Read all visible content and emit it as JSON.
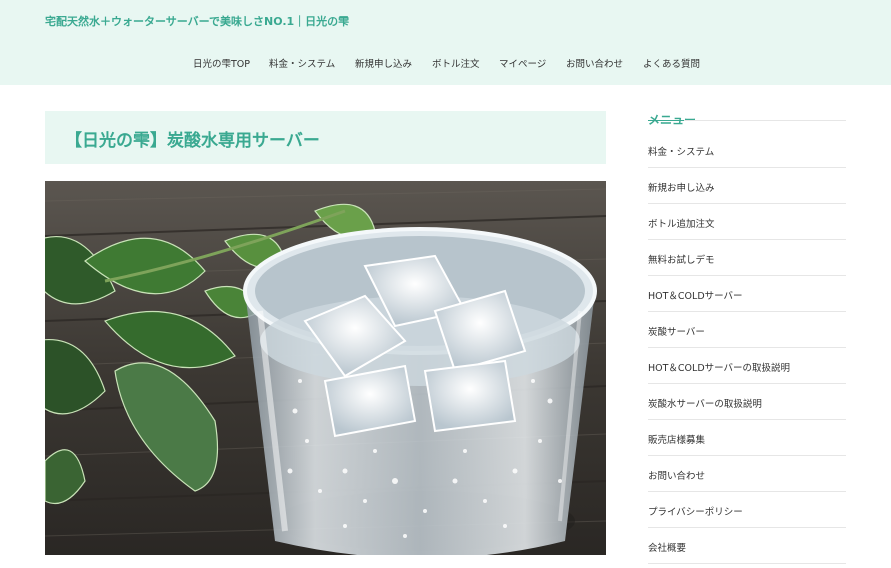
{
  "header": {
    "site_title": "宅配天然水＋ウォーターサーバーで美味しさNO.1｜日光の雫",
    "nav": [
      {
        "label": "日光の雫TOP"
      },
      {
        "label": "料金・システム"
      },
      {
        "label": "新規申し込み"
      },
      {
        "label": "ボトル注文"
      },
      {
        "label": "マイページ"
      },
      {
        "label": "お問い合わせ"
      },
      {
        "label": "よくある質問"
      }
    ]
  },
  "main": {
    "page_title": "【日光の雫】炭酸水専用サーバー"
  },
  "sidebar": {
    "heading": "メニュー",
    "items": [
      {
        "label": "料金・システム"
      },
      {
        "label": "新規お申し込み"
      },
      {
        "label": "ボトル追加注文"
      },
      {
        "label": "無料お試しデモ"
      },
      {
        "label": "HOT＆COLDサーバー"
      },
      {
        "label": "炭酸サーバー"
      },
      {
        "label": "HOT＆COLDサーバーの取扱説明"
      },
      {
        "label": "炭酸水サーバーの取扱説明"
      },
      {
        "label": "販売店様募集"
      },
      {
        "label": "お問い合わせ"
      },
      {
        "label": "プライバシーポリシー"
      },
      {
        "label": "会社概要"
      }
    ]
  },
  "colors": {
    "accent": "#3aa991",
    "header_bg": "#e8f7f2"
  }
}
